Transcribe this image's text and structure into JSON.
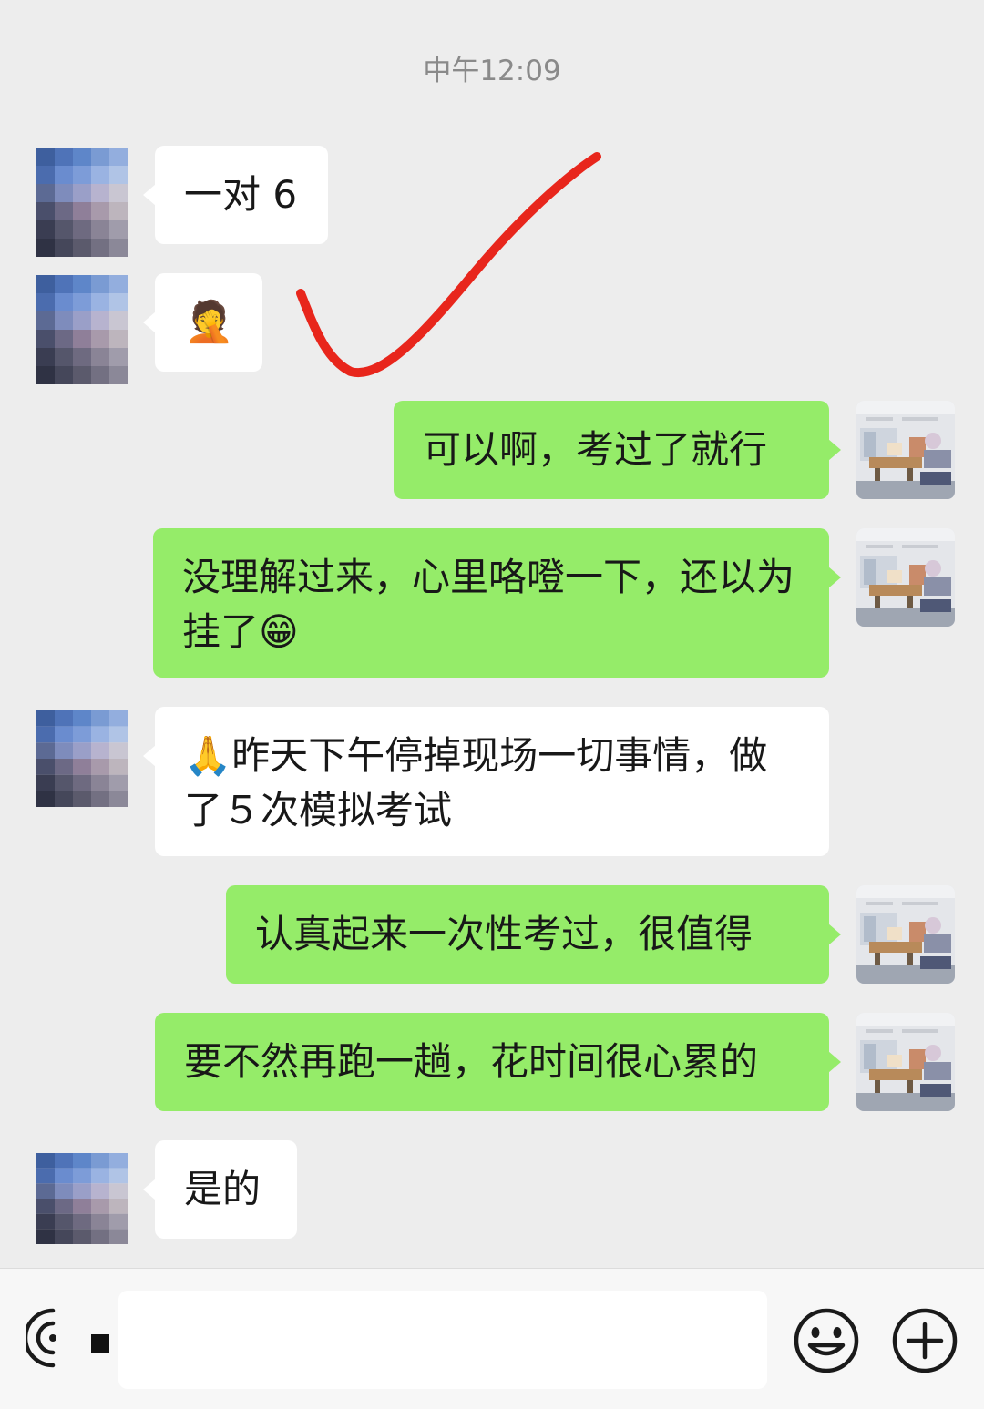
{
  "chat": {
    "timestamp": "中午12:09",
    "messages": [
      {
        "side": "left",
        "text": "一对 6"
      },
      {
        "side": "left",
        "text": "🤦"
      },
      {
        "side": "right",
        "text": "可以啊，考过了就行"
      },
      {
        "side": "right",
        "text": "没理解过来，心里咯噔一下，还以为挂了😁"
      },
      {
        "side": "left",
        "text": "🙏昨天下午停掉现场一切事情，做了５次模拟考试"
      },
      {
        "side": "right",
        "text": "认真起来一次性考过，很值得"
      },
      {
        "side": "right",
        "text": "要不然再跑一趟，花时间很心累的"
      },
      {
        "side": "left",
        "text": "是的"
      }
    ]
  },
  "input_bar": {
    "voice_icon": "voice-icon",
    "emoji_icon": "emoji-icon",
    "plus_icon": "plus-icon",
    "text_value": ""
  },
  "colors": {
    "background": "#ededed",
    "bubble_left": "#ffffff",
    "bubble_right": "#95ec69",
    "annotation": "#e8261c"
  }
}
